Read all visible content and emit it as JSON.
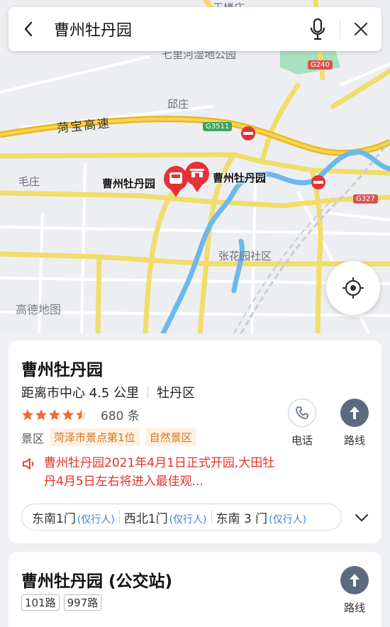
{
  "search": {
    "query": "曹州牡丹园"
  },
  "map": {
    "place_labels": {
      "qiuzhuang": "邱庄",
      "maozhuang": "毛庄",
      "zhanghuayuan": "张花园社区",
      "wetland_park": "七里河湿地公园",
      "top_village": "王楼庄"
    },
    "highway_name": "菏宝高速",
    "shields": {
      "g3511": "G3511",
      "g240": "G240",
      "g327": "G327"
    },
    "poi_labels": {
      "bus": "曹州牡丹园",
      "scenic": "曹州牡丹园"
    },
    "watermark": "高德地图"
  },
  "poi": {
    "name": "曹州牡丹园",
    "distance": "距离市中心 4.5 公里",
    "district": "牡丹区",
    "rating": 4.5,
    "reviews": "680 条",
    "category": "景区",
    "tags": [
      "菏泽市景点第1位",
      "自然景区"
    ],
    "notice": "曹州牡丹园2021年4月1日正式开园,大田牡丹4月5日左右将进入最佳观...",
    "actions": {
      "phone": "电话",
      "route": "路线"
    },
    "gates": [
      {
        "name": "东南1门",
        "note": "(仅行人)"
      },
      {
        "name": "西北1门",
        "note": "(仅行人)"
      },
      {
        "name": "东南 3 门",
        "note": "(仅行人)"
      }
    ]
  },
  "bus_stop": {
    "name": "曹州牡丹园 (公交站)",
    "routes": [
      "101路",
      "997路"
    ],
    "route_label": "路线"
  },
  "colors": {
    "road_yellow": "#f2dc6b",
    "highway": "#e9b820",
    "water": "#6cb8ee",
    "park": "#a9e0bd",
    "marker_red": "#e43238",
    "star": "#f26a2e",
    "notice_red": "#e5332a",
    "tag_orange": "#d0781f"
  },
  "icons": {
    "back": "chevron-left-icon",
    "mic": "microphone-icon",
    "close": "close-icon",
    "locate": "locate-icon",
    "phone": "phone-icon",
    "route": "route-arrow-icon",
    "speaker": "speaker-icon",
    "expand": "chevron-down-icon"
  }
}
